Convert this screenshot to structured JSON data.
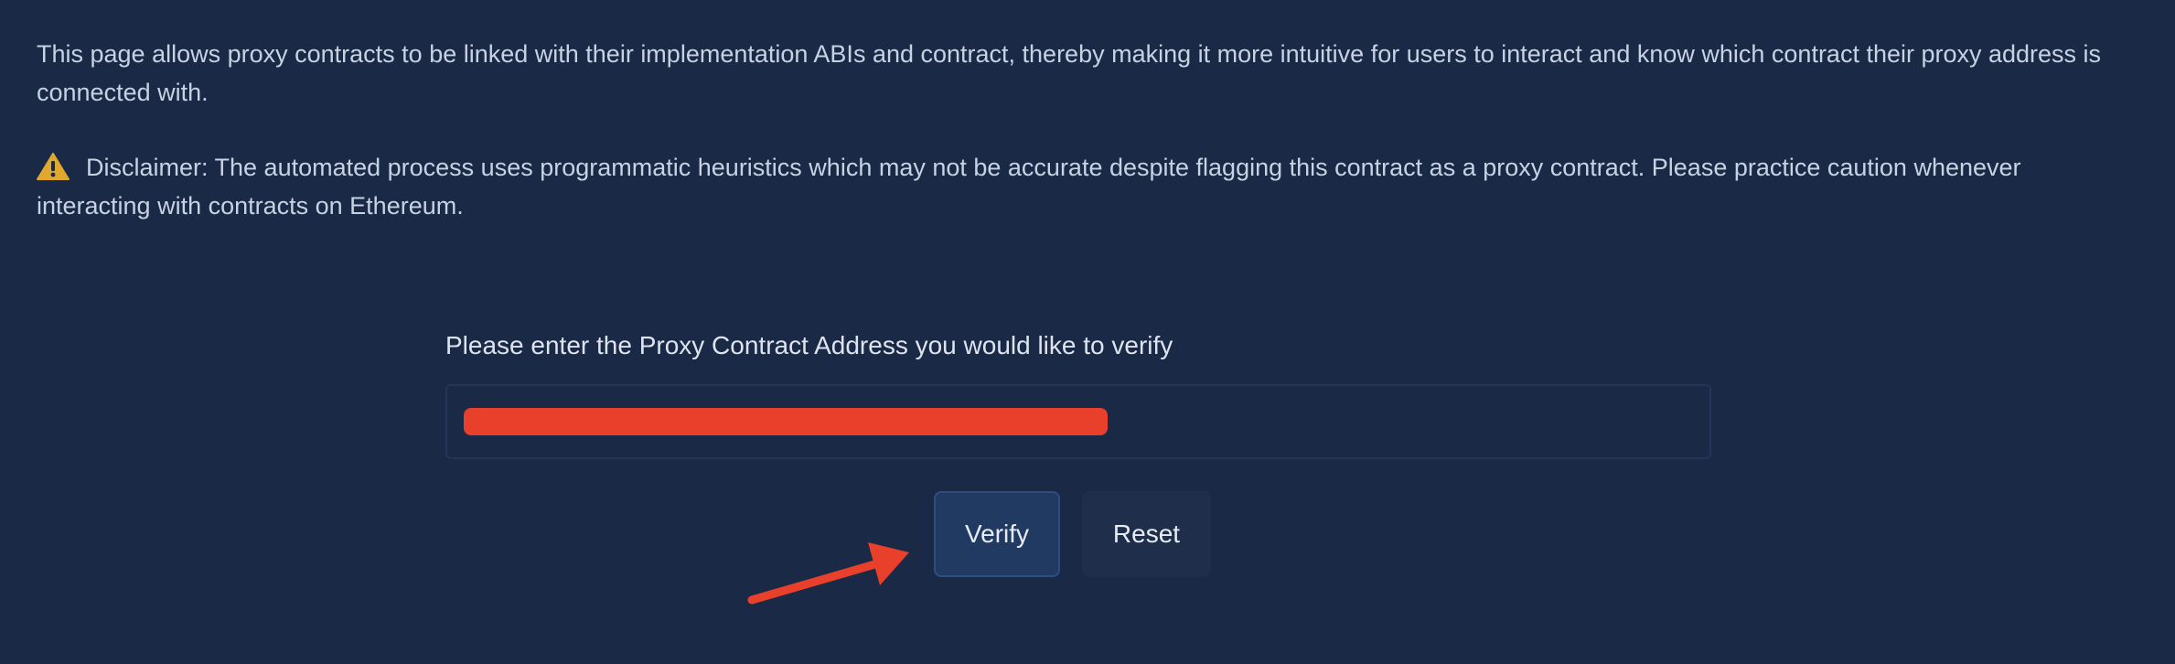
{
  "intro": {
    "text": "This page allows proxy contracts to be linked with their implementation ABIs and contract, thereby making it more intuitive for users to interact and know which contract their proxy address is connected with."
  },
  "disclaimer": {
    "icon": "warning-icon",
    "icon_color": "#e0a82e",
    "text": "Disclaimer: The automated process uses programmatic heuristics which may not be accurate despite flagging this contract as a proxy contract. Please practice caution whenever interacting with contracts on Ethereum."
  },
  "form": {
    "label": "Please enter the Proxy Contract Address you would like to verify",
    "input_value": "",
    "redaction_color": "#e8402b",
    "verify_label": "Verify",
    "reset_label": "Reset"
  },
  "annotation": {
    "type": "arrow",
    "color": "#e8402b",
    "points_to": "verify-button"
  }
}
